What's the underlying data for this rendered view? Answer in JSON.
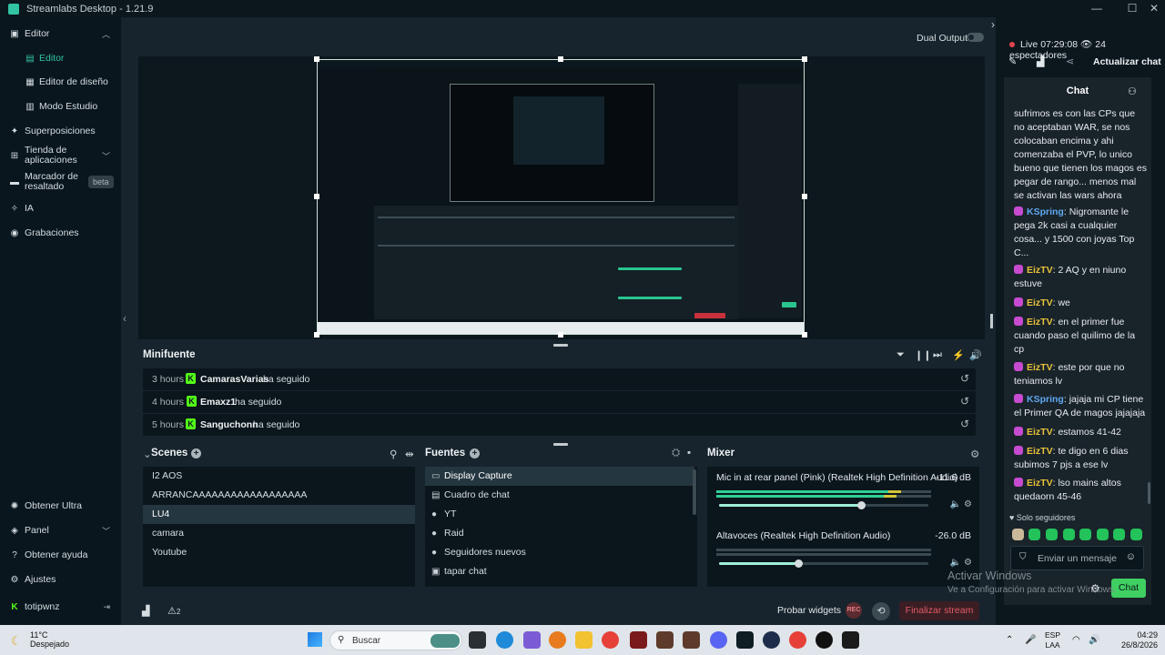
{
  "window": {
    "title": "Streamlabs Desktop - 1.21.9",
    "minimize": "—",
    "maximize": "☐",
    "close": "✕"
  },
  "sidebar": {
    "items": [
      {
        "label": "Editor",
        "icon": "editor-icon"
      },
      {
        "label": "Editor",
        "active": true
      },
      {
        "label": "Editor de diseño"
      },
      {
        "label": "Modo Estudio"
      },
      {
        "label": "Superposiciones",
        "icon": "overlays-icon"
      },
      {
        "label": "Tienda de aplicaciones",
        "icon": "store-icon"
      },
      {
        "label": "Marcador de resaltado",
        "icon": "highlighter-icon",
        "badge": "beta"
      },
      {
        "label": "IA",
        "icon": "ai-icon"
      },
      {
        "label": "Grabaciones",
        "icon": "recordings-icon"
      }
    ],
    "bottom": [
      {
        "label": "Obtener Ultra"
      },
      {
        "label": "Panel"
      },
      {
        "label": "Obtener ayuda"
      },
      {
        "label": "Ajustes"
      },
      {
        "label": "totipwnz"
      }
    ]
  },
  "studio": {
    "dual_output": "Dual Output"
  },
  "minifuente": {
    "title": "Minifuente",
    "events": [
      {
        "time": "3 hours",
        "name": "CamarasVarias",
        "action": "ha seguido"
      },
      {
        "time": "4 hours",
        "name": "Emaxz1",
        "action": "ha seguido"
      },
      {
        "time": "5 hours",
        "name": "Sanguchonn",
        "action": "ha seguido"
      }
    ]
  },
  "scenes": {
    "title": "Scenes",
    "items": [
      "I2 AOS",
      "ARRANCAAAAAAAAAAAAAAAAAA",
      "LU4",
      "camara",
      "Youtube"
    ],
    "selected": 2
  },
  "sources": {
    "title": "Fuentes",
    "items": [
      {
        "label": "Display Capture",
        "icon": "monitor-icon"
      },
      {
        "label": "Cuadro de chat",
        "icon": "chat-icon"
      },
      {
        "label": "YT",
        "icon": "user-icon"
      },
      {
        "label": "Raid",
        "icon": "user-icon"
      },
      {
        "label": "Seguidores nuevos",
        "icon": "user-icon"
      },
      {
        "label": "tapar chat",
        "icon": "image-icon"
      }
    ]
  },
  "mixer": {
    "title": "Mixer",
    "channels": [
      {
        "name": "Mic in at rear panel (Pink) (Realtek High Definition Audio)",
        "db": "-11.6 dB",
        "volume": 0.68
      },
      {
        "name": "Altavoces (Realtek High Definition Audio)",
        "db": "-26.0 dB",
        "volume": 0.38
      }
    ]
  },
  "footer": {
    "alerts_count": "2",
    "test_widgets": "Probar widgets",
    "rec": "REC",
    "end_stream": "Finalizar stream"
  },
  "chat_panel": {
    "status": "Live",
    "uptime": "07:29:08",
    "viewers": "24 espectadores",
    "refresh": "Actualizar chat",
    "title": "Chat",
    "messages": [
      {
        "user": "",
        "text": "sufrimos es con las CPs que no aceptaban WAR, se nos colocaban encima y ahi comenzaba el PVP, lo unico bueno que tienen los magos es pegar de rango... menos mal se activan las wars ahora"
      },
      {
        "user": "KSpring",
        "text": "Nigromante le pega 2k casi a cualquier cosa... y 1500 con joyas Top C..."
      },
      {
        "user": "EizTV",
        "text": "2 AQ y en niuno estuve"
      },
      {
        "user": "EizTV",
        "text": "we"
      },
      {
        "user": "EizTV",
        "text": "en el primer fue cuando paso el quilimo de la cp"
      },
      {
        "user": "EizTV",
        "text": "este por que no teniamos lv"
      },
      {
        "user": "KSpring",
        "text": "jajaja mi CP tiene el Primer QA de magos jajajaja"
      },
      {
        "user": "EizTV",
        "text": "estamos 41-42"
      },
      {
        "user": "EizTV",
        "text": "te digo en 6 dias subimos 7 pjs a ese lv"
      },
      {
        "user": "EizTV",
        "text": "lso mains altos quedaorn 45-46"
      }
    ],
    "followers_only": "Solo seguidores",
    "input_placeholder": "Enviar un mensaje",
    "send": "Chat",
    "colors": {
      "kspring": "#5fa8f0",
      "eiztv": "#e8c33a"
    }
  },
  "watermark": {
    "line1": "Activar Windows",
    "line2": "Ve a Configuración para activar Windows."
  },
  "taskbar": {
    "weather_temp": "11°C",
    "weather_desc": "Despejado",
    "search": "Buscar",
    "lang1": "ESP",
    "lang2": "LAA",
    "time": "04:29",
    "date": "26/8/2026"
  }
}
